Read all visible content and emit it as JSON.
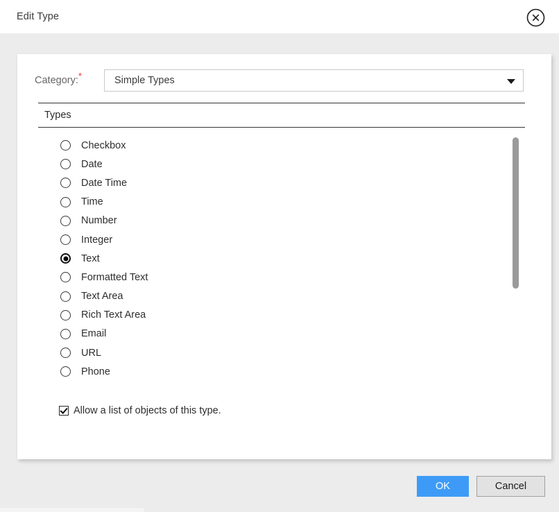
{
  "window": {
    "title": "Edit Type",
    "close_icon": "close-circle-icon"
  },
  "form": {
    "category_label": "Category:",
    "required_marker": "*",
    "category_value": "Simple Types",
    "dropdown_icon": "chevron-down-icon"
  },
  "types_section": {
    "tab_label": "Types",
    "options": [
      {
        "label": "Checkbox",
        "selected": false
      },
      {
        "label": "Date",
        "selected": false
      },
      {
        "label": "Date Time",
        "selected": false
      },
      {
        "label": "Time",
        "selected": false
      },
      {
        "label": "Number",
        "selected": false
      },
      {
        "label": "Integer",
        "selected": false
      },
      {
        "label": "Text",
        "selected": true
      },
      {
        "label": "Formatted Text",
        "selected": false
      },
      {
        "label": "Text Area",
        "selected": false
      },
      {
        "label": "Rich Text Area",
        "selected": false
      },
      {
        "label": "Email",
        "selected": false
      },
      {
        "label": "URL",
        "selected": false
      },
      {
        "label": "Phone",
        "selected": false
      }
    ]
  },
  "allow_list": {
    "label": "Allow a list of objects of this type.",
    "checked": true
  },
  "footer": {
    "ok_label": "OK",
    "cancel_label": "Cancel"
  },
  "colors": {
    "accent": "#3d9bf7",
    "required": "#e8362a",
    "background": "#ececec",
    "panel": "#ffffff",
    "scrollbar": "#9a9a9a"
  }
}
